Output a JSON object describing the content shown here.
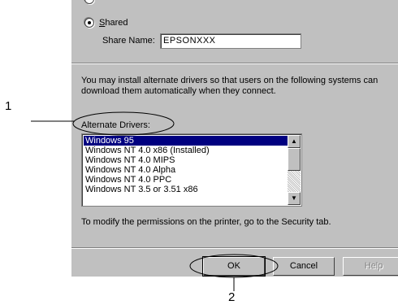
{
  "sharing": {
    "shared_label_underlined": "S",
    "shared_label_rest": "hared",
    "share_name_label": "Share Name:",
    "share_name_value": "EPSONXXX"
  },
  "drivers": {
    "description": "You may install alternate drivers so that users on the following systems can download them automatically when they connect.",
    "alternate_drivers_label": "Alternate Drivers:",
    "items": [
      "Windows 95",
      "Windows NT 4.0 x86 (Installed)",
      "Windows NT 4.0 MIPS",
      "Windows NT 4.0 Alpha",
      "Windows NT 4.0 PPC",
      "Windows NT 3.5 or 3.51 x86"
    ],
    "selected_index": 0
  },
  "permissions_text": "To modify the permissions on the printer, go to the Security tab.",
  "buttons": {
    "ok": "OK",
    "cancel": "Cancel",
    "help": "Help"
  },
  "callouts": {
    "one": "1",
    "two": "2"
  }
}
